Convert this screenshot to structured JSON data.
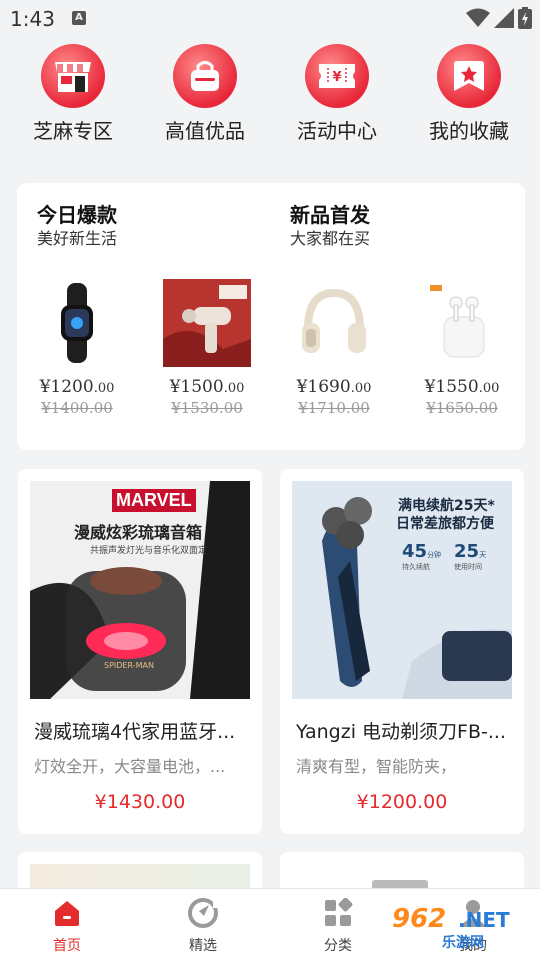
{
  "status_bar": {
    "time": "1:43",
    "notification_icon": "A"
  },
  "quick_nav": [
    {
      "label": "芝麻专区",
      "icon": "storefront-icon"
    },
    {
      "label": "高值优品",
      "icon": "shopping-bag-icon"
    },
    {
      "label": "活动中心",
      "icon": "ticket-icon"
    },
    {
      "label": "我的收藏",
      "icon": "bookmark-star-icon"
    }
  ],
  "panel": {
    "left": {
      "title": "今日爆款",
      "subtitle": "美好新生活"
    },
    "right": {
      "title": "新品首发",
      "subtitle": "大家都在买"
    },
    "products": [
      {
        "price": "¥1200",
        "cents": ".00",
        "old_price": "¥1400.00",
        "icon": "smart-band-image"
      },
      {
        "price": "¥1500",
        "cents": ".00",
        "old_price": "¥1530.00",
        "icon": "massage-gun-image"
      },
      {
        "price": "¥1690",
        "cents": ".00",
        "old_price": "¥1710.00",
        "icon": "headphones-image"
      },
      {
        "price": "¥1550",
        "cents": ".00",
        "old_price": "¥1650.00",
        "icon": "earbuds-image"
      }
    ]
  },
  "cards": [
    {
      "name": "漫威琉璃4代家用蓝牙...",
      "desc": "灯效全开，大容量电池，...",
      "price": "¥1430.00",
      "image": {
        "brand": "MARVEL",
        "headline": "漫威炫彩琉璃音箱",
        "subline": "共振声发灯光与音乐化双面定",
        "product_mark": "SPIDER-MAN"
      }
    },
    {
      "name": "Yangzi 电动剃须刀FB-...",
      "desc": "清爽有型，智能防夹，",
      "price": "¥1200.00",
      "image": {
        "headline1": "满电续航25天*",
        "headline2": "日常差旅都方便",
        "stat1_value": "45",
        "stat1_unit": "分钟",
        "stat1_caption": "持久续航",
        "stat2_value": "25",
        "stat2_unit": "天",
        "stat2_caption": "使用时间"
      }
    }
  ],
  "tabbar": [
    {
      "label": "首页",
      "icon": "home-icon",
      "active": true
    },
    {
      "label": "精选",
      "icon": "compass-icon",
      "active": false
    },
    {
      "label": "分类",
      "icon": "category-grid-icon",
      "active": false
    },
    {
      "label": "我的",
      "icon": "user-icon",
      "active": false
    }
  ],
  "watermark": {
    "number": "962",
    "suffix": ".NET",
    "text": "乐游网"
  },
  "colors": {
    "accent": "#e52b2b",
    "icon_red": "#e8283a",
    "background": "#f2f3f5"
  }
}
